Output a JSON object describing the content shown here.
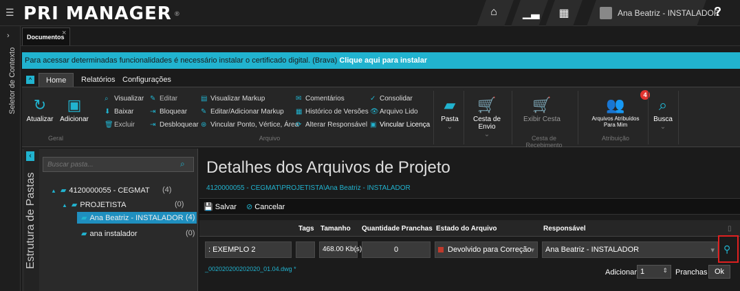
{
  "app": {
    "logo": "PRI MANAGER",
    "logo_mark": "®"
  },
  "topbar": {
    "user": "Ana Beatriz - INSTALADOR",
    "help": "?"
  },
  "rail": {
    "label": "Seletor de Contexto"
  },
  "tab": {
    "label": "Documentos",
    "close": "×"
  },
  "banner": {
    "text": "Para acessar determinadas funcionalidades é necessário instalar o certificado digital. (Brava)",
    "link": "Clique aqui para instalar"
  },
  "ribbon_tabs": [
    "Home",
    "Relatórios",
    "Configurações"
  ],
  "ribbon": {
    "atualizar": "Atualizar",
    "adicionar": "Adicionar",
    "visualizar": "Visualizar",
    "baixar": "Baixar",
    "excluir": "Excluir",
    "editar": "Editar",
    "bloquear": "Bloquear",
    "desbloquear": "Desbloquear",
    "visualizar_markup": "Visualizar Markup",
    "editar_markup": "Editar/Adicionar Markup",
    "vincular_ponto": "Vincular Ponto, Vértice, Área",
    "comentarios": "Comentários",
    "historico": "Histórico de Versões",
    "alterar_responsavel": "Alterar Responsável",
    "consolidar": "Consolidar",
    "arquivo_lido": "Arquivo Lido",
    "vincular_licenca": "Vincular Licença",
    "pasta": "Pasta",
    "cesta_envio": "Cesta de Envio",
    "exibir_cesta": "Exibir Cesta",
    "arquivos_atribuidos_1": "Arquivos Atribuídos",
    "arquivos_atribuidos_2": "Para Mim",
    "badge": "4",
    "busca": "Busca",
    "groups": {
      "geral": "Geral",
      "arquivo": "Arquivo",
      "cesta": "Cesta de Recebimento",
      "atribuicao": "Atribuição"
    }
  },
  "folders": {
    "panel_label": "Estrutura de Pastas",
    "search_placeholder": "Buscar pasta...",
    "items": [
      {
        "name": "4120000055 - CEGMAT",
        "count": "(4)"
      },
      {
        "name": "PROJETISTA",
        "count": "(0)"
      },
      {
        "name": "Ana Beatriz - INSTALADOR",
        "count": "(4)"
      },
      {
        "name": "ana instalador",
        "count": "(0)"
      }
    ]
  },
  "main": {
    "title": "Detalhes dos Arquivos de Projeto",
    "path": "4120000055 - CEGMAT\\PROJETISTA\\Ana Beatriz - INSTALADOR",
    "save": "Salvar",
    "cancel": "Cancelar",
    "columns": [
      "Tags",
      "Tamanho",
      "Quantidade Pranchas",
      "Estado do Arquivo",
      "Responsável"
    ],
    "row": {
      "name": ": EXEMPLO 2",
      "tags": "",
      "size": "468.00 Kb(s)",
      "pranchas": "0",
      "estado": "Devolvido para Correção",
      "responsavel": "Ana Beatriz - INSTALADOR"
    },
    "file": "_002020200202020_01.04.dwg *",
    "pager": {
      "adicionar": "Adicionar",
      "value": "1",
      "pranchas": "Pranchas",
      "ok": "Ok"
    }
  },
  "colors": {
    "accent": "#21b3cf",
    "alert": "#e02020"
  }
}
